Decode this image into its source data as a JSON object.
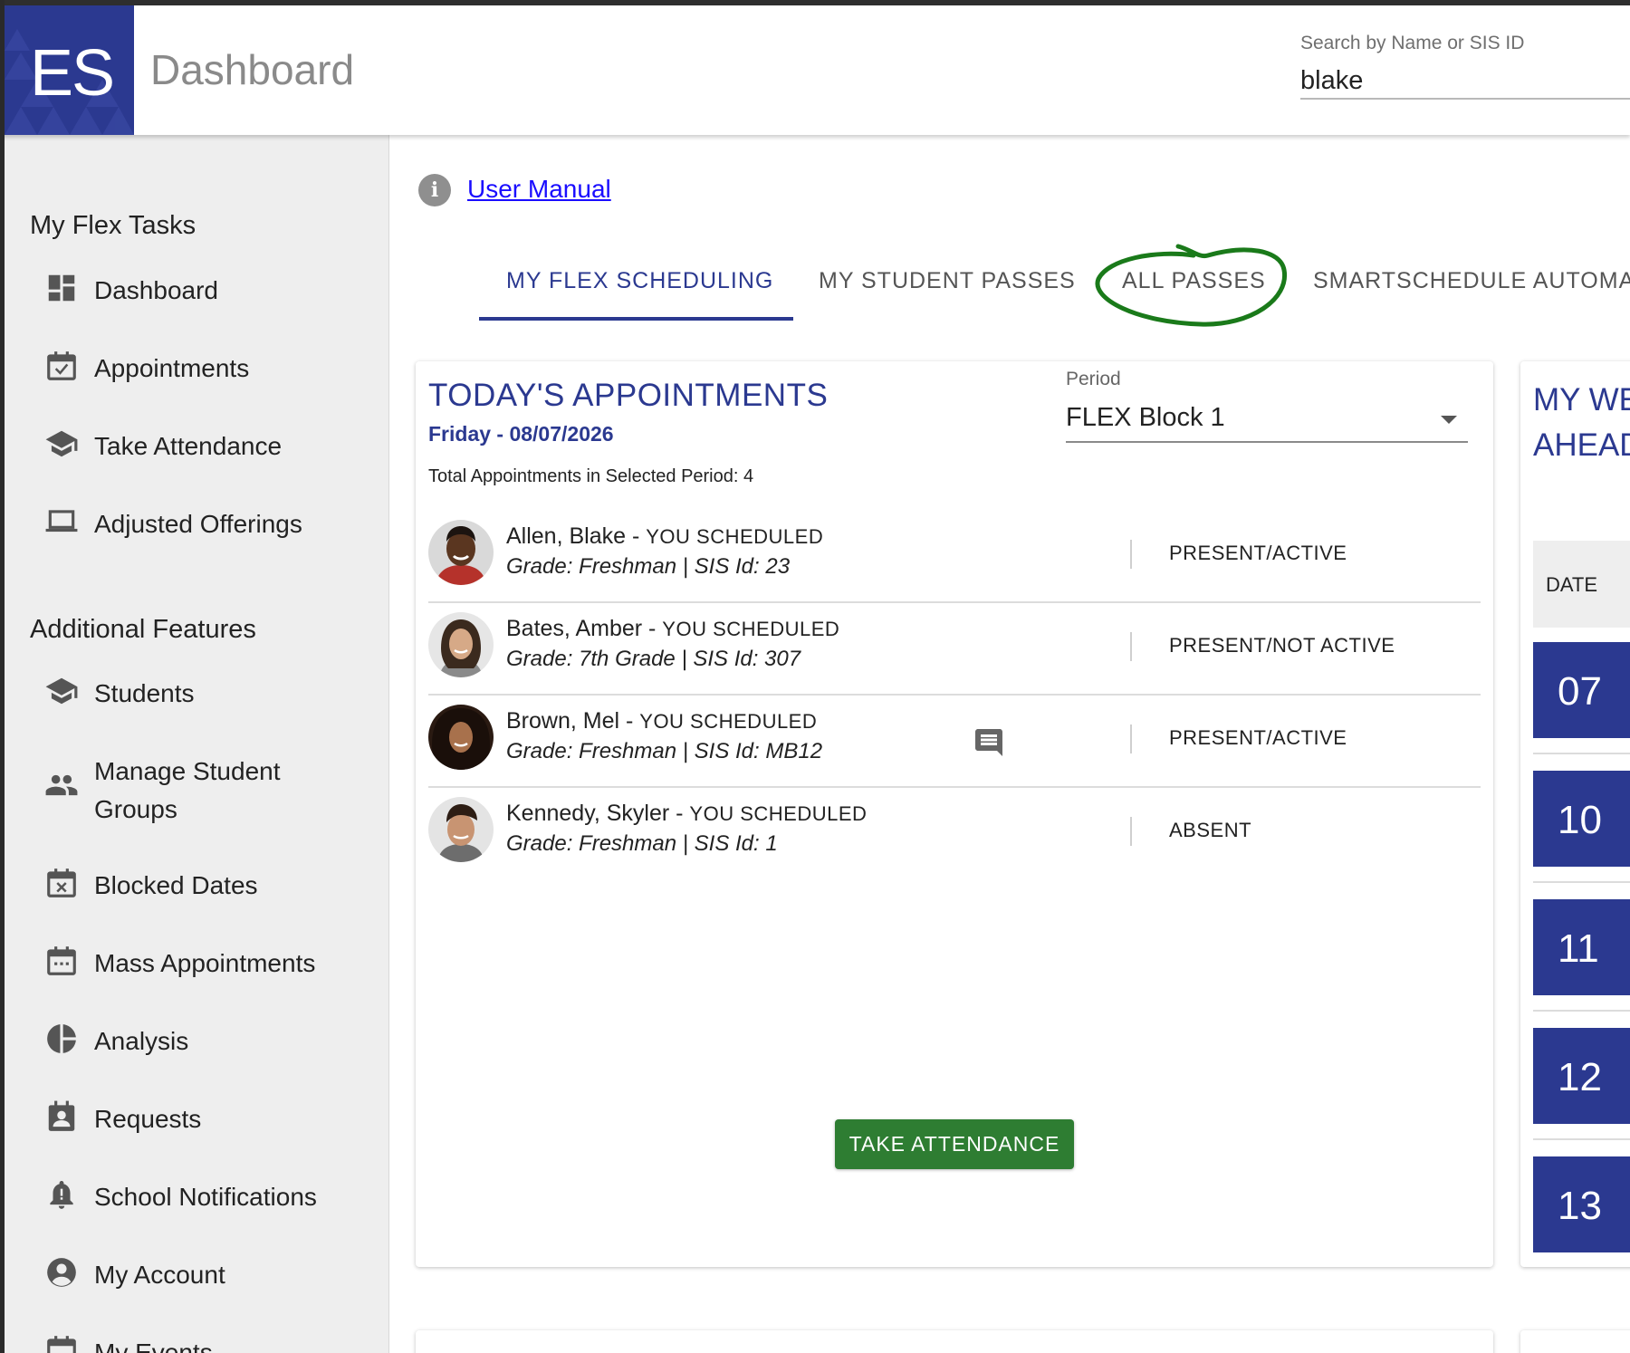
{
  "header": {
    "logo_text": "ES",
    "title": "Dashboard",
    "search_label": "Search by Name or SIS ID",
    "search_value": "blake"
  },
  "sidebar": {
    "section1_title": "My Flex Tasks",
    "section1_items": [
      {
        "label": "Dashboard",
        "icon": "dashboard-icon"
      },
      {
        "label": "Appointments",
        "icon": "calendar-check-icon"
      },
      {
        "label": "Take Attendance",
        "icon": "graduation-cap-icon"
      },
      {
        "label": "Adjusted Offerings",
        "icon": "laptop-icon"
      }
    ],
    "section2_title": "Additional Features",
    "section2_items": [
      {
        "label": "Students",
        "icon": "graduation-cap-icon"
      },
      {
        "label_line1": "Manage Student",
        "label_line2": "Groups",
        "icon": "people-icon"
      },
      {
        "label": "Blocked Dates",
        "icon": "calendar-x-icon"
      },
      {
        "label": "Mass Appointments",
        "icon": "calendar-dots-icon"
      },
      {
        "label": "Analysis",
        "icon": "pie-chart-icon"
      },
      {
        "label": "Requests",
        "icon": "contact-calendar-icon"
      },
      {
        "label": "School Notifications",
        "icon": "bell-alert-icon"
      },
      {
        "label": "My Account",
        "icon": "account-circle-icon"
      },
      {
        "label": "My Events",
        "icon": "calendar-icon"
      }
    ]
  },
  "main": {
    "info_glyph": "i",
    "user_manual": "User Manual",
    "tabs": [
      {
        "label": "MY FLEX SCHEDULING",
        "active": true
      },
      {
        "label": "MY STUDENT PASSES",
        "active": false
      },
      {
        "label": "ALL PASSES",
        "active": false
      },
      {
        "label": "SMARTSCHEDULE AUTOMATIONS",
        "active": false
      }
    ],
    "highlight_color": "#1a7a1a"
  },
  "appointments": {
    "title": "TODAY'S APPOINTMENTS",
    "date": "Friday - 08/07/2026",
    "total": "Total Appointments in Selected Period: 4",
    "period_label": "Period",
    "period_value": "FLEX Block 1",
    "students": [
      {
        "name": "Allen, Blake",
        "tag": "YOU SCHEDULED",
        "meta": "Grade: Freshman  |  SIS Id: 23",
        "status": "PRESENT/ACTIVE",
        "has_comment": false
      },
      {
        "name": "Bates, Amber",
        "tag": "YOU SCHEDULED",
        "meta": "Grade: 7th Grade  |  SIS Id: 307",
        "status": "PRESENT/NOT ACTIVE",
        "has_comment": false
      },
      {
        "name": "Brown, Mel",
        "tag": "YOU SCHEDULED",
        "meta": "Grade: Freshman  |  SIS Id: MB12",
        "status": "PRESENT/ACTIVE",
        "has_comment": true
      },
      {
        "name": "Kennedy, Skyler",
        "tag": "YOU SCHEDULED",
        "meta": "Grade: Freshman  |  SIS Id: 1",
        "status": "ABSENT",
        "has_comment": false
      }
    ],
    "separator": " - ",
    "button": "TAKE ATTENDANCE"
  },
  "week_ahead": {
    "title_line1": "MY WEEK",
    "title_line2": "AHEAD",
    "date_header": "DATE",
    "days": [
      "07",
      "10",
      "11",
      "12",
      "13"
    ]
  },
  "colors": {
    "brand": "#2b3990",
    "success": "#2e7d32",
    "sidebar_bg": "#eeeeee"
  }
}
